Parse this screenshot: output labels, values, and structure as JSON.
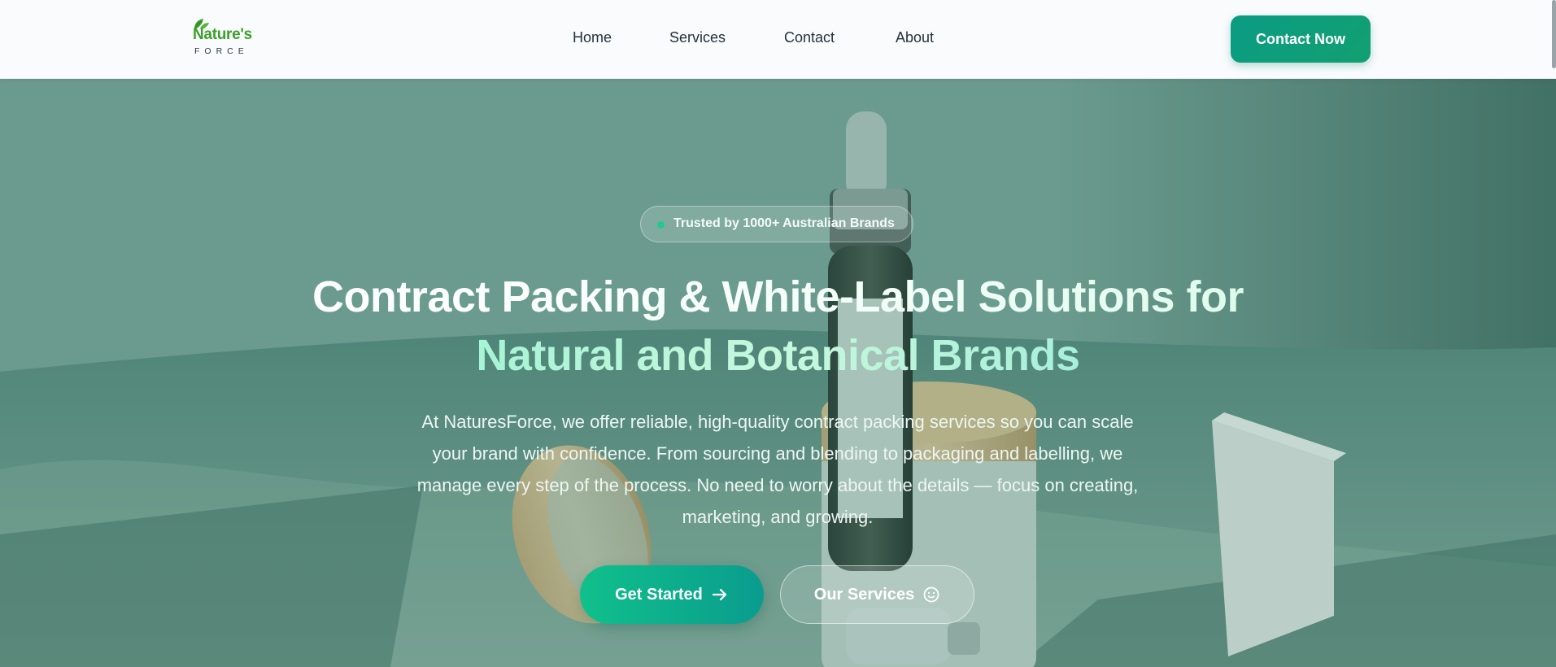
{
  "header": {
    "logo": {
      "name_top": "Nature's",
      "name_bottom": "FORCE"
    },
    "nav": [
      {
        "label": "Home"
      },
      {
        "label": "Services"
      },
      {
        "label": "Contact"
      },
      {
        "label": "About"
      }
    ],
    "cta_label": "Contact Now"
  },
  "hero": {
    "badge": "Trusted by 1000+ Australian Brands",
    "headline_line1": "Contract Packing & White-Label Solutions for",
    "headline_line2": "Natural and Botanical Brands",
    "description": "At NaturesForce, we offer reliable, high-quality contract packing services so you can scale your brand with confidence. From sourcing and blending to packaging and labelling, we manage every step of the process. No need to worry about the details — focus on creating, marketing, and growing.",
    "primary_button": "Get Started",
    "primary_button_icon": "arrow-right-icon",
    "secondary_button": "Our Services",
    "secondary_button_icon": "smile-icon"
  },
  "colors": {
    "brand_green": "#3aa02a",
    "accent_teal": "#0a9c84",
    "nav_text": "#23323a",
    "badge_dot": "#22c98e"
  }
}
